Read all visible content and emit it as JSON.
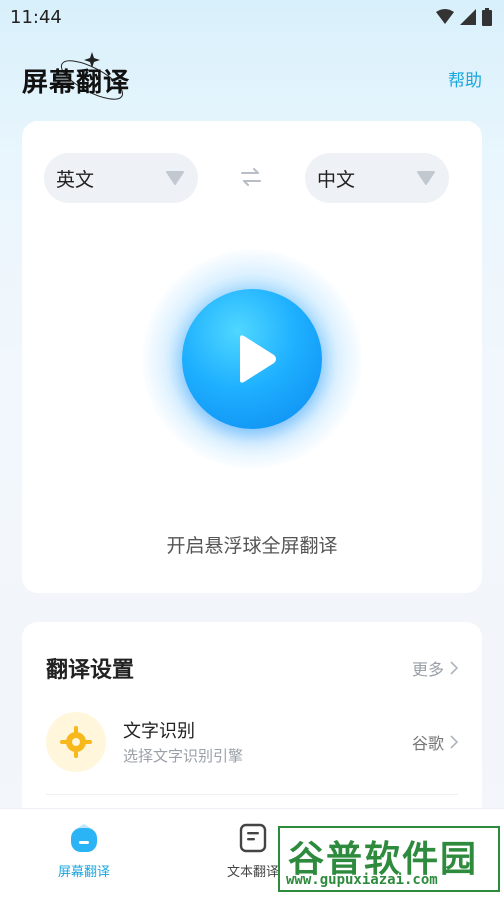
{
  "status_bar": {
    "time": "11:44"
  },
  "header": {
    "title": "屏幕翻译",
    "help_label": "帮助"
  },
  "languages": {
    "source": "英文",
    "target": "中文"
  },
  "main": {
    "start_caption": "开启悬浮球全屏翻译"
  },
  "settings": {
    "title": "翻译设置",
    "more_label": "更多",
    "ocr": {
      "title": "文字识别",
      "subtitle": "选择文字识别引擎",
      "value": "谷歌"
    }
  },
  "bottom_nav": {
    "items": [
      {
        "label": "屏幕翻译"
      },
      {
        "label": "文本翻译"
      }
    ]
  },
  "watermark": {
    "cn": "谷普软件园",
    "url": "www.gupuxiazai.com"
  },
  "colors": {
    "accent": "#1aa7e0",
    "play_gradient_start": "#4fd7ff",
    "play_gradient_end": "#0a88f0",
    "watermark": "#2e8b3d"
  }
}
